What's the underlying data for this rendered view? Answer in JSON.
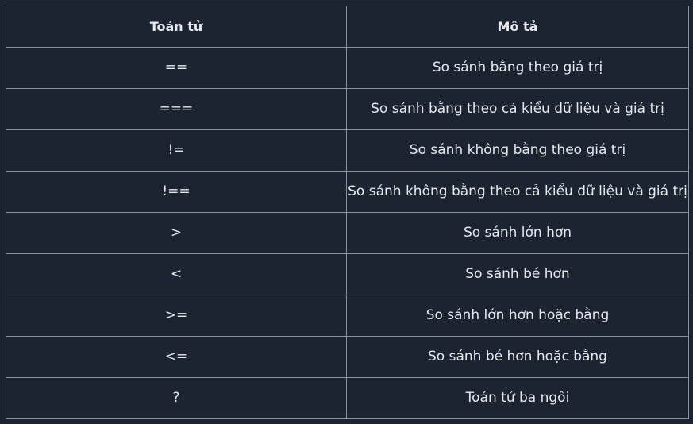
{
  "table": {
    "headers": [
      "Toán tử",
      "Mô tả"
    ],
    "rows": [
      [
        "==",
        "So sánh bằng theo giá trị"
      ],
      [
        "===",
        "So sánh bằng theo cả kiểu dữ liệu và giá trị"
      ],
      [
        "!=",
        "So sánh không bằng theo giá trị"
      ],
      [
        "!==",
        "So sánh không bằng theo cả kiểu dữ liệu và giá trị"
      ],
      [
        ">",
        "So sánh lớn hơn"
      ],
      [
        "<",
        "So sánh bé hơn"
      ],
      [
        ">=",
        "So sánh lớn hơn hoặc bằng"
      ],
      [
        "<=",
        "So sánh bé hơn hoặc bằng"
      ],
      [
        "?",
        "Toán tử ba ngôi"
      ]
    ]
  }
}
